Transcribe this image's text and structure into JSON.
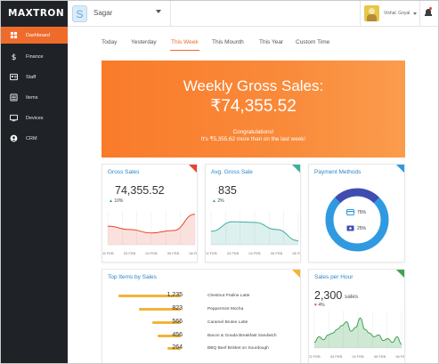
{
  "app": {
    "logo": "MAXTRON"
  },
  "topbar": {
    "store_initial": "S",
    "store_name": "Sagar",
    "user_name": "Vishal. Goyal"
  },
  "sidebar": {
    "items": [
      {
        "label": "Dashboard",
        "icon": "dashboard-icon",
        "active": true
      },
      {
        "label": "Finance",
        "icon": "dollar-icon"
      },
      {
        "label": "Staff",
        "icon": "id-card-icon"
      },
      {
        "label": "Items",
        "icon": "list-icon"
      },
      {
        "label": "Devices",
        "icon": "monitor-icon"
      },
      {
        "label": "CRM",
        "icon": "user-circle-icon"
      }
    ]
  },
  "tabs": [
    {
      "label": "Today"
    },
    {
      "label": "Yesterday"
    },
    {
      "label": "This Week",
      "active": true
    },
    {
      "label": "This Mounth"
    },
    {
      "label": "This Year"
    },
    {
      "label": "Custom Time"
    }
  ],
  "hero": {
    "title": "Weekly Gross Sales:",
    "amount": "₹74,355.52",
    "congrats": "Congratulations!",
    "more": "It's ₹5,355.62 more than on the last week!"
  },
  "colors": {
    "accent": "#ee6b2c",
    "title_blue": "#2a86c8",
    "red": "#e8452c",
    "teal": "#3dae9e",
    "blue": "#2f9ae0",
    "navy": "#3f4db0",
    "yellow": "#f2b43a",
    "green": "#3ea352"
  },
  "gross_sales": {
    "title": "Gross Sales",
    "value": "74,355.52",
    "delta": "10%",
    "ticks": [
      "02 FEB",
      "03 FEB",
      "04 FEB",
      "05 FEB",
      "06 FEB"
    ]
  },
  "avg_gross_sale": {
    "title": "Avg. Gross Sale",
    "value": "835",
    "delta": "2%",
    "ticks": [
      "02 FEB",
      "03 FEB",
      "04 FEB",
      "05 FEB",
      "06 FEB"
    ]
  },
  "payment_methods": {
    "title": "Payment Methods",
    "card_pct": "75%",
    "cash_pct": "25%",
    "card_share": 0.75,
    "cash_share": 0.25
  },
  "top_items": {
    "title": "Top Items by Sales",
    "items": [
      {
        "value": "1,235",
        "name": "Chestnut Praline Latte",
        "amount": 1235
      },
      {
        "value": "823",
        "name": "Peppermint Mocha",
        "amount": 823
      },
      {
        "value": "566",
        "name": "Caramel Brulee Latte",
        "amount": 566
      },
      {
        "value": "456",
        "name": "Bacon & Gouda Breakfast Sandwich",
        "amount": 456
      },
      {
        "value": "264",
        "name": "BBQ Beef Brisket on Sourdough",
        "amount": 264
      }
    ]
  },
  "sales_per_hour": {
    "title": "Sales per Hour",
    "value": "2,300",
    "unit": "sales",
    "delta": "4%",
    "ticks": [
      "02 FEB",
      "03 FEB",
      "04 FEB",
      "05 FEB",
      "06 FEB"
    ]
  },
  "chart_data": [
    {
      "type": "area",
      "title": "Gross Sales",
      "x": [
        "02 FEB",
        "03 FEB",
        "04 FEB",
        "05 FEB",
        "06 FEB"
      ],
      "values": [
        0.55,
        0.45,
        0.35,
        0.42,
        0.9
      ],
      "grid": true
    },
    {
      "type": "area",
      "title": "Avg. Gross Sale",
      "x": [
        "02 FEB",
        "03 FEB",
        "04 FEB",
        "05 FEB",
        "06 FEB"
      ],
      "values": [
        0.4,
        0.68,
        0.66,
        0.45,
        0.12
      ],
      "grid": true
    },
    {
      "type": "pie",
      "title": "Payment Methods",
      "categories": [
        "Card",
        "Cash"
      ],
      "values": [
        75,
        25
      ]
    },
    {
      "type": "bar",
      "title": "Top Items by Sales",
      "categories": [
        "Chestnut Praline Latte",
        "Peppermint Mocha",
        "Caramel Brulee Latte",
        "Bacon & Gouda Breakfast Sandwich",
        "BBQ Beef Brisket on Sourdough"
      ],
      "values": [
        1235,
        823,
        566,
        456,
        264
      ]
    },
    {
      "type": "area",
      "title": "Sales per Hour",
      "x": [
        "02 FEB",
        "03 FEB",
        "04 FEB",
        "05 FEB",
        "06 FEB"
      ],
      "values": [
        0.15,
        0.3,
        0.22,
        0.35,
        0.4,
        0.5,
        0.6,
        0.7,
        0.45,
        0.55,
        0.8,
        0.5,
        0.4,
        0.3,
        0.35,
        0.2,
        0.25,
        0.15,
        0.3,
        0.1
      ],
      "grid": true
    }
  ]
}
